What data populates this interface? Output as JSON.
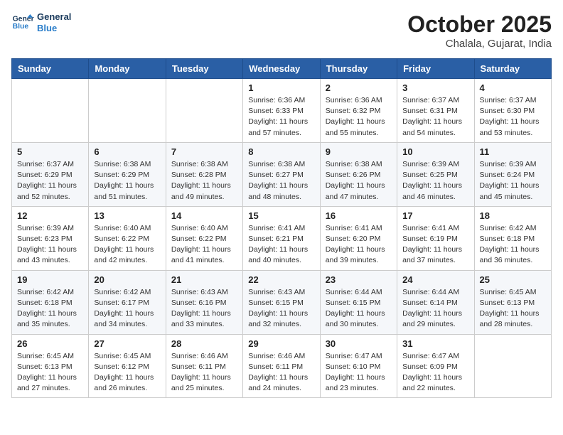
{
  "header": {
    "logo_line1": "General",
    "logo_line2": "Blue",
    "month": "October 2025",
    "location": "Chalala, Gujarat, India"
  },
  "weekdays": [
    "Sunday",
    "Monday",
    "Tuesday",
    "Wednesday",
    "Thursday",
    "Friday",
    "Saturday"
  ],
  "weeks": [
    [
      {
        "day": "",
        "info": ""
      },
      {
        "day": "",
        "info": ""
      },
      {
        "day": "",
        "info": ""
      },
      {
        "day": "1",
        "info": "Sunrise: 6:36 AM\nSunset: 6:33 PM\nDaylight: 11 hours\nand 57 minutes."
      },
      {
        "day": "2",
        "info": "Sunrise: 6:36 AM\nSunset: 6:32 PM\nDaylight: 11 hours\nand 55 minutes."
      },
      {
        "day": "3",
        "info": "Sunrise: 6:37 AM\nSunset: 6:31 PM\nDaylight: 11 hours\nand 54 minutes."
      },
      {
        "day": "4",
        "info": "Sunrise: 6:37 AM\nSunset: 6:30 PM\nDaylight: 11 hours\nand 53 minutes."
      }
    ],
    [
      {
        "day": "5",
        "info": "Sunrise: 6:37 AM\nSunset: 6:29 PM\nDaylight: 11 hours\nand 52 minutes."
      },
      {
        "day": "6",
        "info": "Sunrise: 6:38 AM\nSunset: 6:29 PM\nDaylight: 11 hours\nand 51 minutes."
      },
      {
        "day": "7",
        "info": "Sunrise: 6:38 AM\nSunset: 6:28 PM\nDaylight: 11 hours\nand 49 minutes."
      },
      {
        "day": "8",
        "info": "Sunrise: 6:38 AM\nSunset: 6:27 PM\nDaylight: 11 hours\nand 48 minutes."
      },
      {
        "day": "9",
        "info": "Sunrise: 6:38 AM\nSunset: 6:26 PM\nDaylight: 11 hours\nand 47 minutes."
      },
      {
        "day": "10",
        "info": "Sunrise: 6:39 AM\nSunset: 6:25 PM\nDaylight: 11 hours\nand 46 minutes."
      },
      {
        "day": "11",
        "info": "Sunrise: 6:39 AM\nSunset: 6:24 PM\nDaylight: 11 hours\nand 45 minutes."
      }
    ],
    [
      {
        "day": "12",
        "info": "Sunrise: 6:39 AM\nSunset: 6:23 PM\nDaylight: 11 hours\nand 43 minutes."
      },
      {
        "day": "13",
        "info": "Sunrise: 6:40 AM\nSunset: 6:22 PM\nDaylight: 11 hours\nand 42 minutes."
      },
      {
        "day": "14",
        "info": "Sunrise: 6:40 AM\nSunset: 6:22 PM\nDaylight: 11 hours\nand 41 minutes."
      },
      {
        "day": "15",
        "info": "Sunrise: 6:41 AM\nSunset: 6:21 PM\nDaylight: 11 hours\nand 40 minutes."
      },
      {
        "day": "16",
        "info": "Sunrise: 6:41 AM\nSunset: 6:20 PM\nDaylight: 11 hours\nand 39 minutes."
      },
      {
        "day": "17",
        "info": "Sunrise: 6:41 AM\nSunset: 6:19 PM\nDaylight: 11 hours\nand 37 minutes."
      },
      {
        "day": "18",
        "info": "Sunrise: 6:42 AM\nSunset: 6:18 PM\nDaylight: 11 hours\nand 36 minutes."
      }
    ],
    [
      {
        "day": "19",
        "info": "Sunrise: 6:42 AM\nSunset: 6:18 PM\nDaylight: 11 hours\nand 35 minutes."
      },
      {
        "day": "20",
        "info": "Sunrise: 6:42 AM\nSunset: 6:17 PM\nDaylight: 11 hours\nand 34 minutes."
      },
      {
        "day": "21",
        "info": "Sunrise: 6:43 AM\nSunset: 6:16 PM\nDaylight: 11 hours\nand 33 minutes."
      },
      {
        "day": "22",
        "info": "Sunrise: 6:43 AM\nSunset: 6:15 PM\nDaylight: 11 hours\nand 32 minutes."
      },
      {
        "day": "23",
        "info": "Sunrise: 6:44 AM\nSunset: 6:15 PM\nDaylight: 11 hours\nand 30 minutes."
      },
      {
        "day": "24",
        "info": "Sunrise: 6:44 AM\nSunset: 6:14 PM\nDaylight: 11 hours\nand 29 minutes."
      },
      {
        "day": "25",
        "info": "Sunrise: 6:45 AM\nSunset: 6:13 PM\nDaylight: 11 hours\nand 28 minutes."
      }
    ],
    [
      {
        "day": "26",
        "info": "Sunrise: 6:45 AM\nSunset: 6:13 PM\nDaylight: 11 hours\nand 27 minutes."
      },
      {
        "day": "27",
        "info": "Sunrise: 6:45 AM\nSunset: 6:12 PM\nDaylight: 11 hours\nand 26 minutes."
      },
      {
        "day": "28",
        "info": "Sunrise: 6:46 AM\nSunset: 6:11 PM\nDaylight: 11 hours\nand 25 minutes."
      },
      {
        "day": "29",
        "info": "Sunrise: 6:46 AM\nSunset: 6:11 PM\nDaylight: 11 hours\nand 24 minutes."
      },
      {
        "day": "30",
        "info": "Sunrise: 6:47 AM\nSunset: 6:10 PM\nDaylight: 11 hours\nand 23 minutes."
      },
      {
        "day": "31",
        "info": "Sunrise: 6:47 AM\nSunset: 6:09 PM\nDaylight: 11 hours\nand 22 minutes."
      },
      {
        "day": "",
        "info": ""
      }
    ]
  ]
}
